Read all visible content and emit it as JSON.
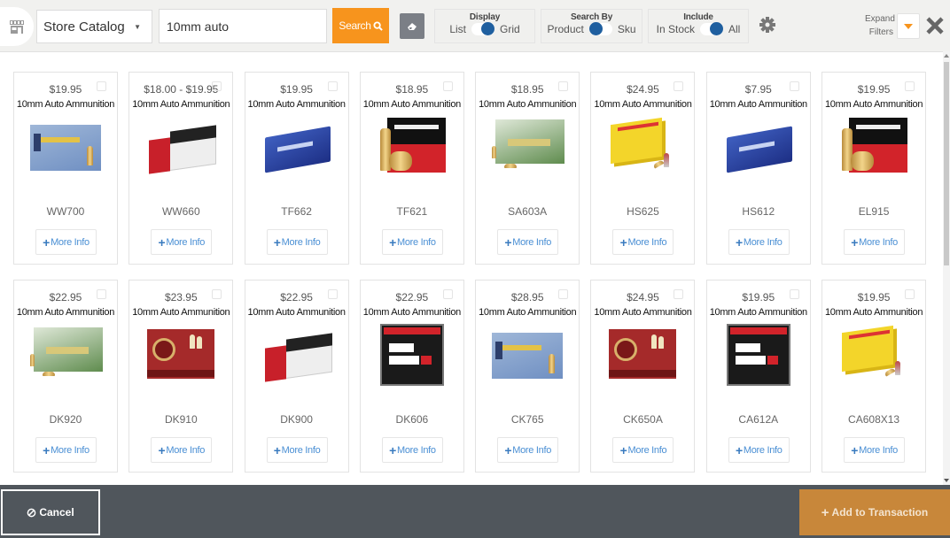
{
  "header": {
    "catalog_select": {
      "value": "Store Catalog"
    },
    "search": {
      "value": "10mm auto",
      "placeholder": ""
    },
    "search_button": "Search",
    "display_toggle": {
      "title": "Display",
      "left": "List",
      "right": "Grid",
      "selected": "Grid"
    },
    "search_by_toggle": {
      "title": "Search By",
      "left": "Product",
      "right": "Sku",
      "selected": "Product"
    },
    "include_toggle": {
      "title": "Include",
      "left": "In Stock",
      "right": "All",
      "selected": "All"
    },
    "expand_filters": {
      "line1": "Expand",
      "line2": "Filters"
    },
    "icons": {
      "store": "store-icon",
      "clear": "eraser-icon",
      "settings": "gear-icon",
      "expand": "caret-down-icon",
      "close": "close-icon"
    }
  },
  "products": [
    {
      "price": "$19.95",
      "name": "10mm Auto Ammunition",
      "sku": "WW700",
      "more": "More Info",
      "image": "blue-box"
    },
    {
      "price": "$18.00 - $19.95",
      "name": "10mm Auto Ammunition",
      "sku": "WW660",
      "more": "More Info",
      "image": "red-white-box"
    },
    {
      "price": "$19.95",
      "name": "10mm Auto Ammunition",
      "sku": "TF662",
      "more": "More Info",
      "image": "magtech-box"
    },
    {
      "price": "$18.95",
      "name": "10mm Auto Ammunition",
      "sku": "TF621",
      "more": "More Info",
      "image": "american-eagle-box"
    },
    {
      "price": "$18.95",
      "name": "10mm Auto Ammunition",
      "sku": "SA603A",
      "more": "More Info",
      "image": "remington-box"
    },
    {
      "price": "$24.95",
      "name": "10mm Auto Ammunition",
      "sku": "HS625",
      "more": "More Info",
      "image": "yellow-box"
    },
    {
      "price": "$7.95",
      "name": "10mm Auto Ammunition",
      "sku": "HS612",
      "more": "More Info",
      "image": "magtech-box"
    },
    {
      "price": "$19.95",
      "name": "10mm Auto Ammunition",
      "sku": "EL915",
      "more": "More Info",
      "image": "american-eagle-box"
    },
    {
      "price": "$22.95",
      "name": "10mm Auto Ammunition",
      "sku": "DK920",
      "more": "More Info",
      "image": "remington-box"
    },
    {
      "price": "$23.95",
      "name": "10mm Auto Ammunition",
      "sku": "DK910",
      "more": "More Info",
      "image": "drt-box"
    },
    {
      "price": "$22.95",
      "name": "10mm Auto Ammunition",
      "sku": "DK900",
      "more": "More Info",
      "image": "red-white-box"
    },
    {
      "price": "$22.95",
      "name": "10mm Auto Ammunition",
      "sku": "DK606",
      "more": "More Info",
      "image": "big-bore-box"
    },
    {
      "price": "$28.95",
      "name": "10mm Auto Ammunition",
      "sku": "CK765",
      "more": "More Info",
      "image": "blue-box"
    },
    {
      "price": "$24.95",
      "name": "10mm Auto Ammunition",
      "sku": "CK650A",
      "more": "More Info",
      "image": "drt-box"
    },
    {
      "price": "$19.95",
      "name": "10mm Auto Ammunition",
      "sku": "CA612A",
      "more": "More Info",
      "image": "big-bore-box"
    },
    {
      "price": "$19.95",
      "name": "10mm Auto Ammunition",
      "sku": "CA608X13",
      "more": "More Info",
      "image": "yellow-box"
    }
  ],
  "footer": {
    "cancel": "Cancel",
    "add": "Add to Transaction"
  },
  "colors": {
    "accent": "#f7941d",
    "toggle_knob": "#1f5f9f",
    "footer_bg": "#50565c",
    "add_button": "#c8873a",
    "link": "#4a8fd4"
  }
}
